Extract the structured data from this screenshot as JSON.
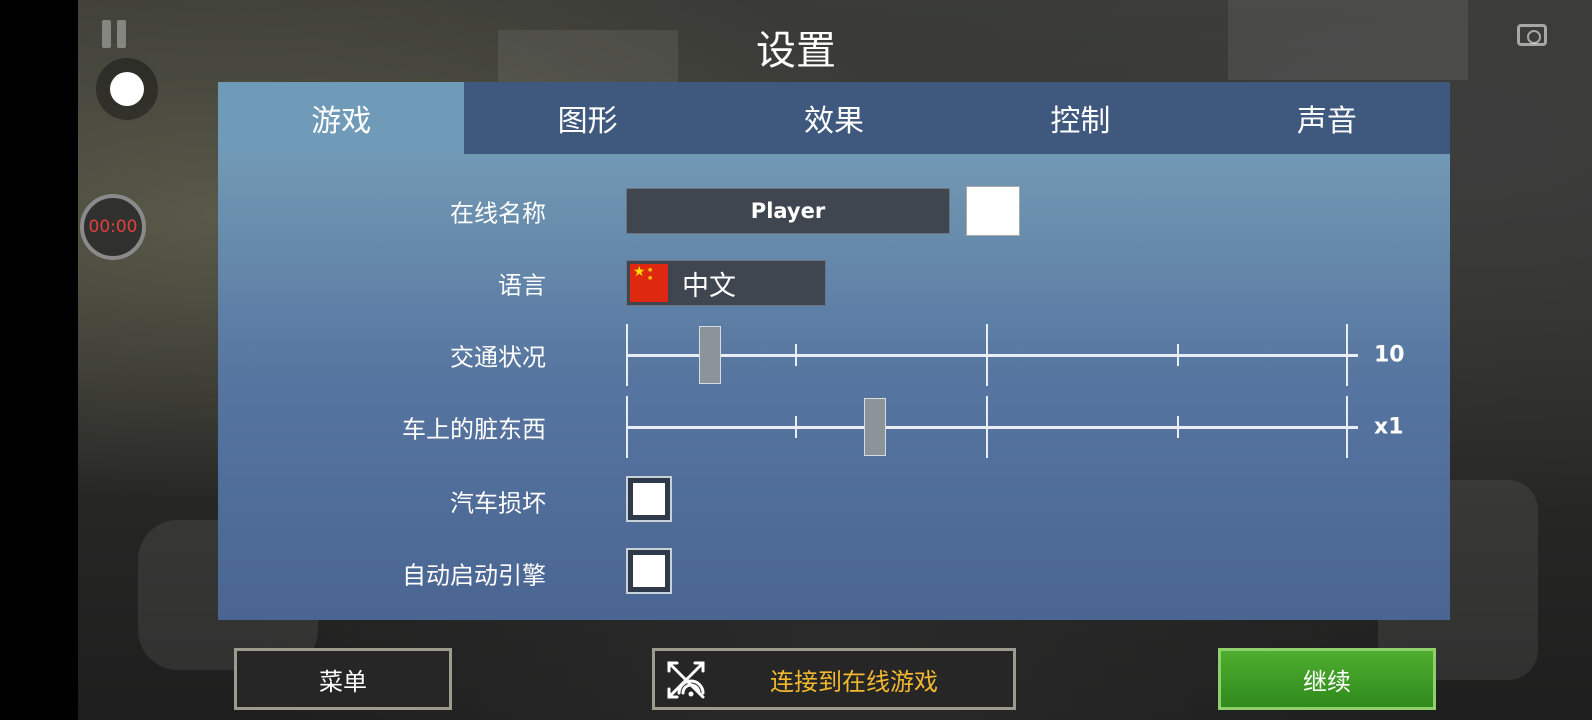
{
  "title": "设置",
  "timer": "00:00",
  "tabs": [
    {
      "label": "游戏",
      "active": true
    },
    {
      "label": "图形",
      "active": false
    },
    {
      "label": "效果",
      "active": false
    },
    {
      "label": "控制",
      "active": false
    },
    {
      "label": "声音",
      "active": false
    }
  ],
  "settings": {
    "online_name": {
      "label": "在线名称",
      "value": "Player",
      "color": "#ffffff"
    },
    "language": {
      "label": "语言",
      "value": "中文"
    },
    "traffic": {
      "label": "交通状况",
      "value_label": "10",
      "position": 0.115
    },
    "dirt": {
      "label": "车上的脏东西",
      "value_label": "x1",
      "position": 0.34
    },
    "car_damage": {
      "label": "汽车损坏",
      "checked": false
    },
    "auto_start_engine": {
      "label": "自动启动引擎",
      "checked": false
    }
  },
  "buttons": {
    "menu": "菜单",
    "online": "连接到在线游戏",
    "continue": "继续"
  },
  "colors": {
    "panel_top": "#7aa4bc",
    "panel_bottom": "#4a6592",
    "tab_bar": "#3f587e",
    "tab_active": "#6f9bb8",
    "continue_green": "#3c9c24",
    "online_text": "#f2b830",
    "timer_text": "#e04040"
  }
}
